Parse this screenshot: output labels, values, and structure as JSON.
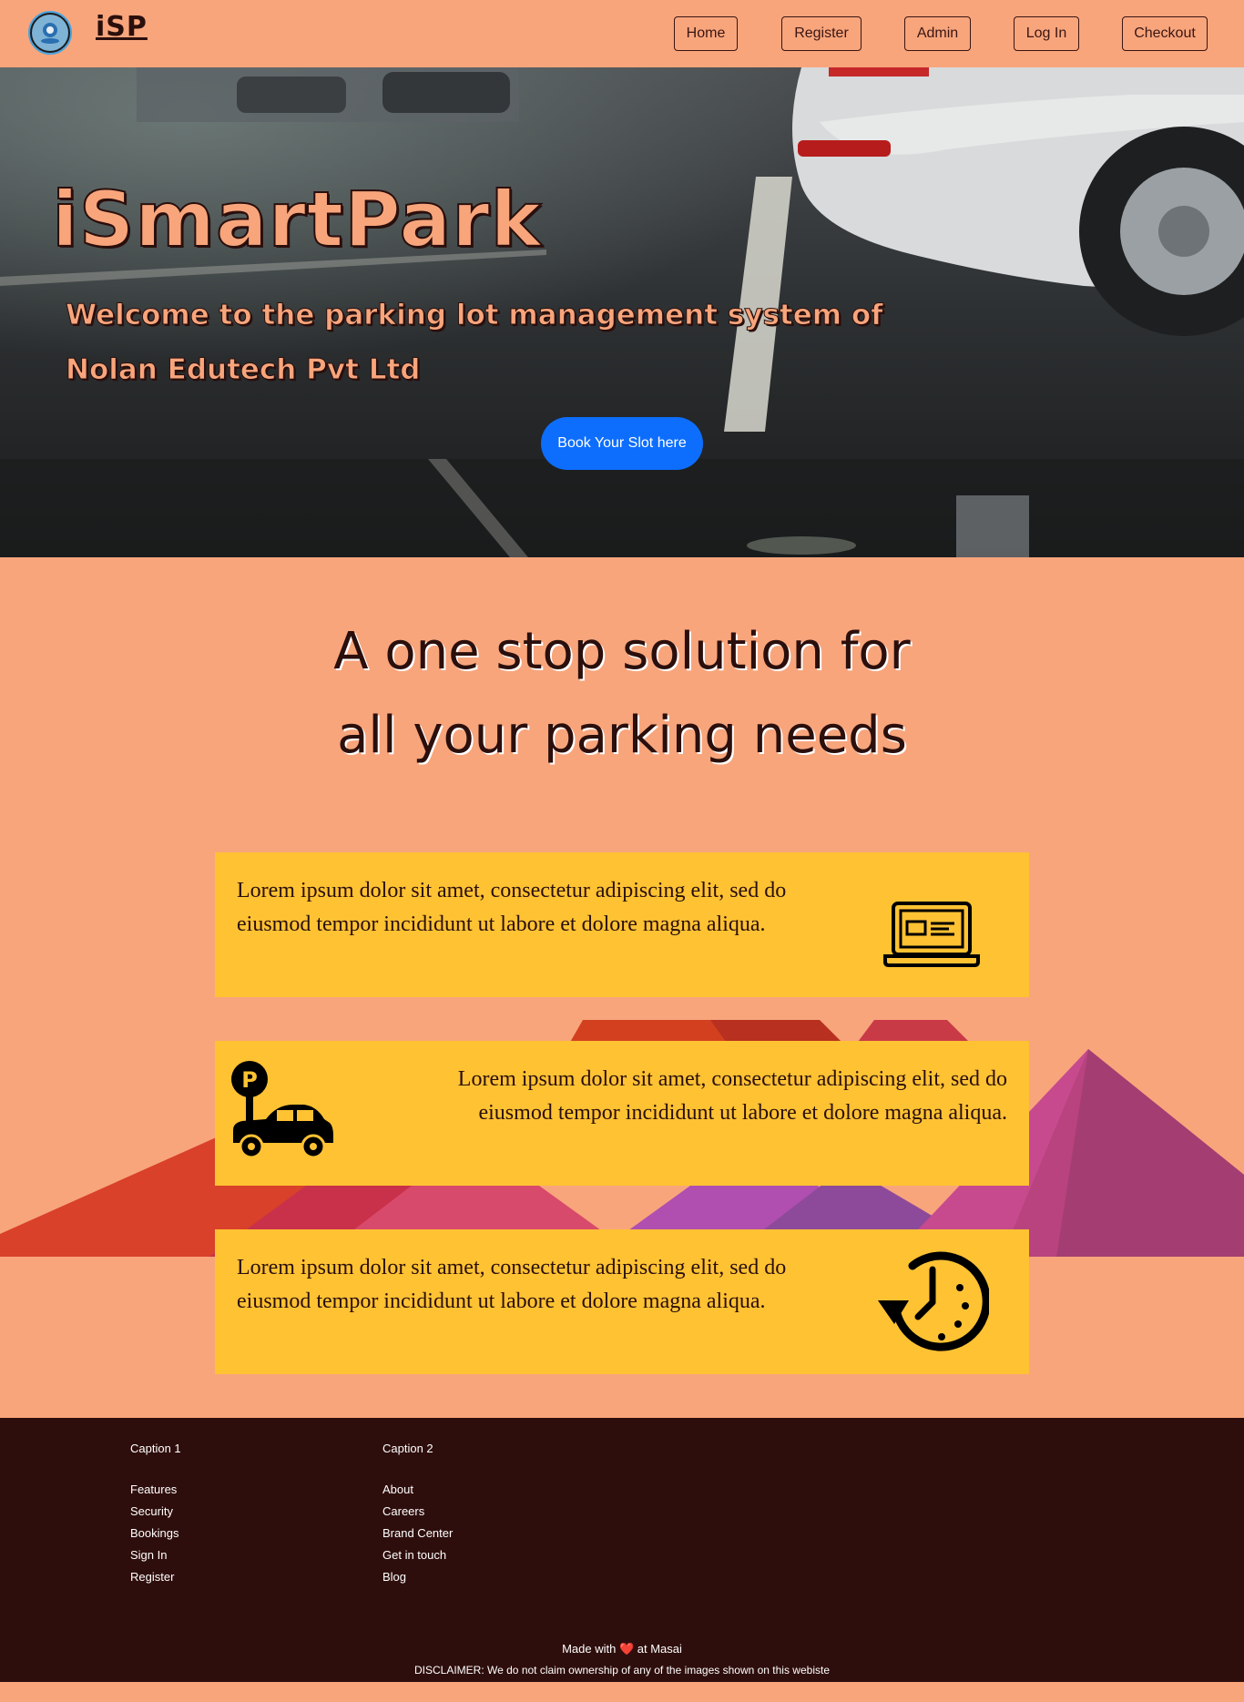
{
  "navbar": {
    "brand": "iSP",
    "links": [
      "Home",
      "Register",
      "Admin",
      "Log In",
      "Checkout"
    ]
  },
  "hero": {
    "title": "iSmartPark",
    "subtitle": "Welcome to the parking lot management system of Nolan Edutech Pvt Ltd",
    "cta_label": "Book Your Slot here"
  },
  "tagline": {
    "line1": "A one stop solution for",
    "line2": "all your parking needs"
  },
  "features": [
    {
      "text": "Lorem ipsum dolor sit amet, consectetur adipiscing elit, sed do eiusmod tempor incididunt ut labore et dolore magna aliqua.",
      "icon": "laptop-icon"
    },
    {
      "text": "Lorem ipsum dolor sit amet, consectetur adipiscing elit, sed do eiusmod tempor incididunt ut labore et dolore magna aliqua.",
      "icon": "parking-car-icon"
    },
    {
      "text": "Lorem ipsum dolor sit amet, consectetur adipiscing elit, sed do eiusmod tempor incididunt ut labore et dolore magna aliqua.",
      "icon": "clock-history-icon"
    }
  ],
  "footer": {
    "caption1": "Caption 1",
    "col1_links": [
      "Features",
      "Security",
      "Bookings",
      "Sign In",
      "Register"
    ],
    "caption2": "Caption 2",
    "col2_links": [
      "About",
      "Careers",
      "Brand Center",
      "Get in touch",
      "Blog"
    ],
    "made_with_prefix": "Made with",
    "made_with_heart": "❤️",
    "made_with_suffix": "at Masai",
    "disclaimer": "DISCLAIMER: We do not claim ownership of any of the images shown on this webiste"
  },
  "colors": {
    "page_bg": "#f8a57c",
    "card_bg": "#ffc233",
    "footer_bg": "#2e0e0c",
    "cta_blue": "#0d6efd",
    "dark_text": "#2a0f0c"
  }
}
